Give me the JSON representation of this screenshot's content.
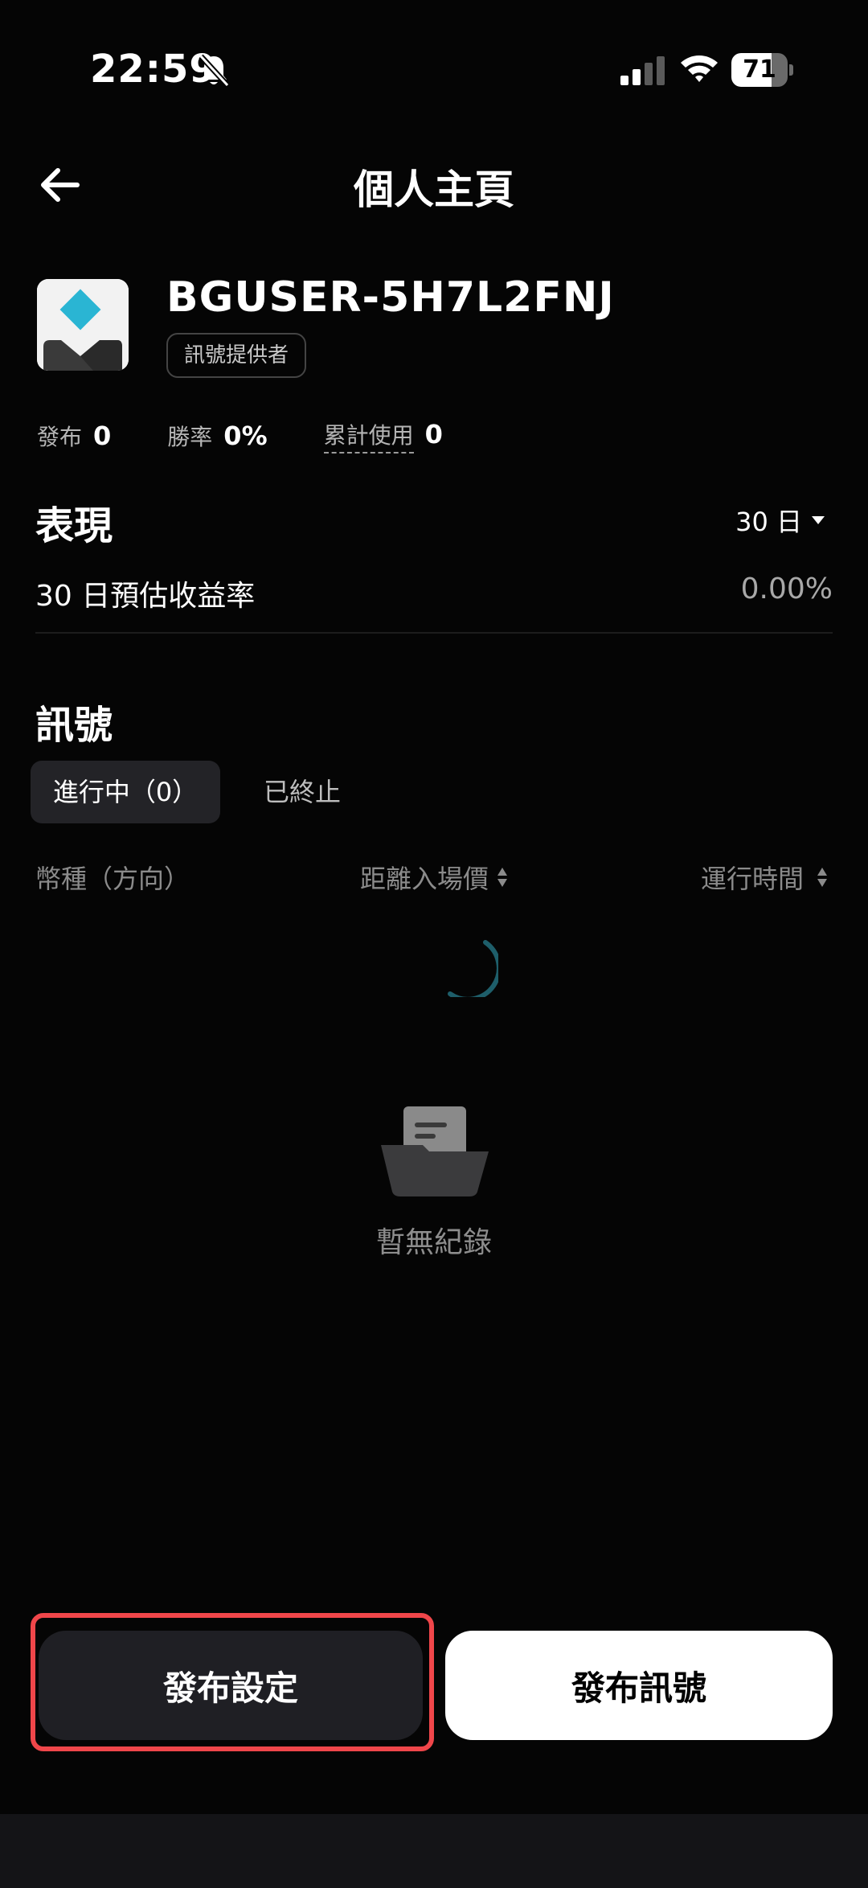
{
  "status_bar": {
    "time": "22:59",
    "battery_level": "71"
  },
  "header": {
    "title": "個人主頁"
  },
  "profile": {
    "username": "BGUSER-5H7L2FNJ",
    "role": "訊號提供者",
    "stats": [
      {
        "label": "發布",
        "value": "0"
      },
      {
        "label": "勝率",
        "value": "0%"
      },
      {
        "label": "累計使用",
        "value": "0"
      }
    ]
  },
  "performance": {
    "title": "表現",
    "period": "30 日",
    "yield_label": "30 日預估收益率",
    "yield_value": "0.00%"
  },
  "signals": {
    "title": "訊號",
    "tabs": [
      {
        "label": "進行中（0）",
        "active": true
      },
      {
        "label": "已終止",
        "active": false
      }
    ],
    "columns": {
      "currency": "幣種（方向）",
      "distance": "距離入場價",
      "runtime": "運行時間"
    },
    "empty_text": "暫無紀錄"
  },
  "actions": {
    "settings_label": "發布設定",
    "publish_label": "發布訊號",
    "highlight_color": "#f0464a"
  }
}
